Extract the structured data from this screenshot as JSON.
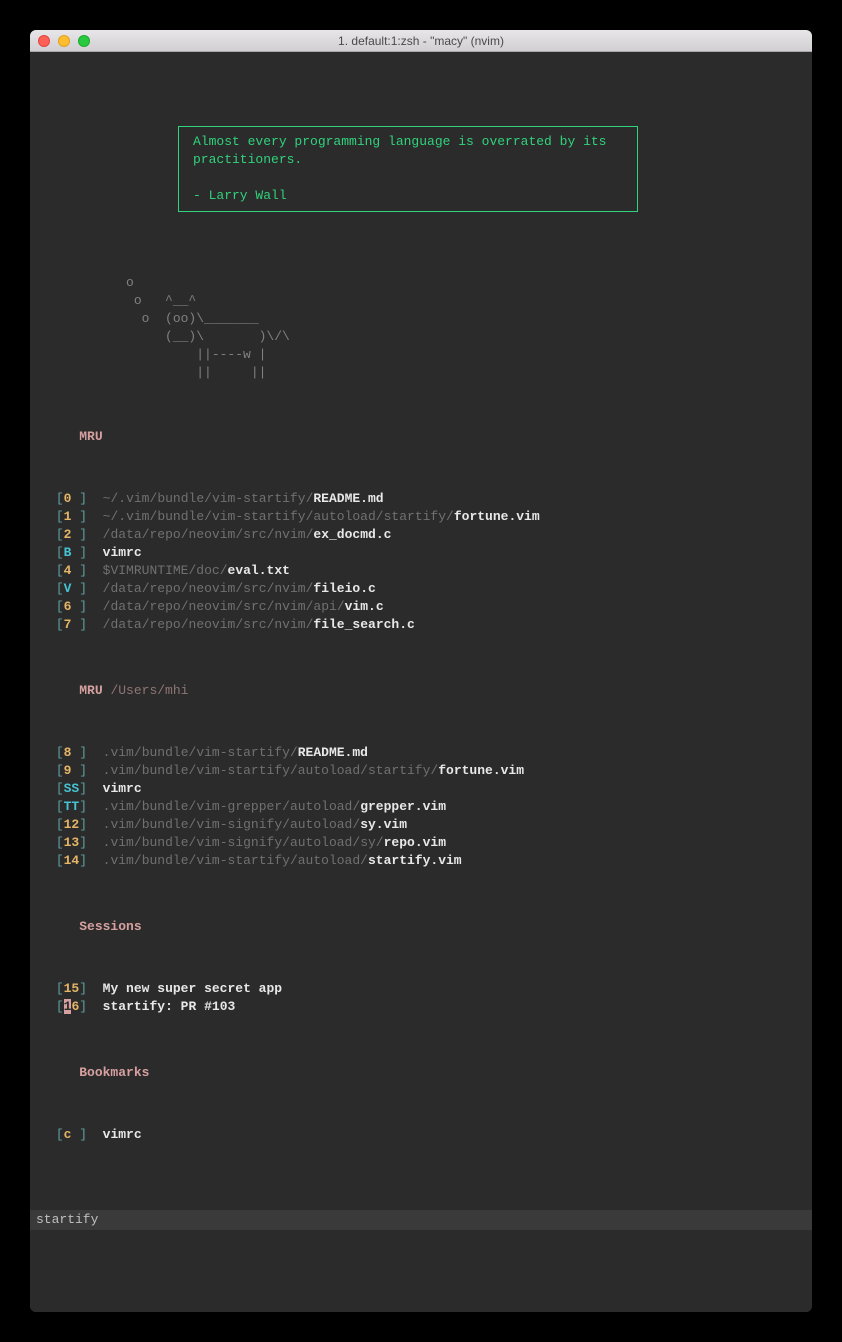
{
  "window": {
    "title": "1. default:1:zsh - \"macy\"  (nvim)"
  },
  "quote": {
    "text": "Almost every programming language is overrated by its practitioners.",
    "author": "- Larry Wall"
  },
  "ascii": "          o\n           o   ^__^\n            o  (oo)\\_______\n               (__)\\       )\\/\\\n                   ||----w |\n                   ||     ||",
  "sections": {
    "mru": {
      "label": "MRU"
    },
    "mru_cwd": {
      "label": "MRU",
      "path": "/Users/mhi"
    },
    "sessions": {
      "label": "Sessions"
    },
    "bookmarks": {
      "label": "Bookmarks"
    }
  },
  "mru": [
    {
      "key": "0",
      "kc": "key",
      "dim": "~/.vim/bundle/vim-startify/",
      "br": "README.md"
    },
    {
      "key": "1",
      "kc": "key",
      "dim": "~/.vim/bundle/vim-startify/autoload/startify/",
      "br": "fortune.vim"
    },
    {
      "key": "2",
      "kc": "key",
      "dim": "/data/repo/neovim/src/nvim/",
      "br": "ex_docmd.c"
    },
    {
      "key": "B",
      "kc": "key cyan",
      "dim": "",
      "br": "vimrc"
    },
    {
      "key": "4",
      "kc": "key",
      "dim": "$VIMRUNTIME/doc/",
      "br": "eval.txt"
    },
    {
      "key": "V",
      "kc": "key cyan",
      "dim": "/data/repo/neovim/src/nvim/",
      "br": "fileio.c"
    },
    {
      "key": "6",
      "kc": "key",
      "dim": "/data/repo/neovim/src/nvim/api/",
      "br": "vim.c"
    },
    {
      "key": "7",
      "kc": "key",
      "dim": "/data/repo/neovim/src/nvim/",
      "br": "file_search.c"
    }
  ],
  "mru_cwd_items": [
    {
      "key": "8",
      "kc": "key",
      "dim": ".vim/bundle/vim-startify/",
      "br": "README.md"
    },
    {
      "key": "9",
      "kc": "key",
      "dim": ".vim/bundle/vim-startify/autoload/startify/",
      "br": "fortune.vim"
    },
    {
      "key": "SS",
      "kc": "key cyan",
      "dim": "",
      "br": "vimrc"
    },
    {
      "key": "TT",
      "kc": "key cyan",
      "dim": ".vim/bundle/vim-grepper/autoload/",
      "br": "grepper.vim"
    },
    {
      "key": "12",
      "kc": "key",
      "dim": ".vim/bundle/vim-signify/autoload/",
      "br": "sy.vim"
    },
    {
      "key": "13",
      "kc": "key",
      "dim": ".vim/bundle/vim-signify/autoload/sy/",
      "br": "repo.vim"
    },
    {
      "key": "14",
      "kc": "key",
      "dim": ".vim/bundle/vim-startify/autoload/",
      "br": "startify.vim"
    }
  ],
  "sessions_items": [
    {
      "key": "15",
      "kc": "key",
      "br": "My new super secret app",
      "cursor": false
    },
    {
      "key": "16",
      "kc": "key",
      "br": "startify: PR #103",
      "cursor": true
    }
  ],
  "bookmarks_items": [
    {
      "key": "c",
      "kc": "key",
      "br": "vimrc"
    }
  ],
  "statusline": "startify"
}
